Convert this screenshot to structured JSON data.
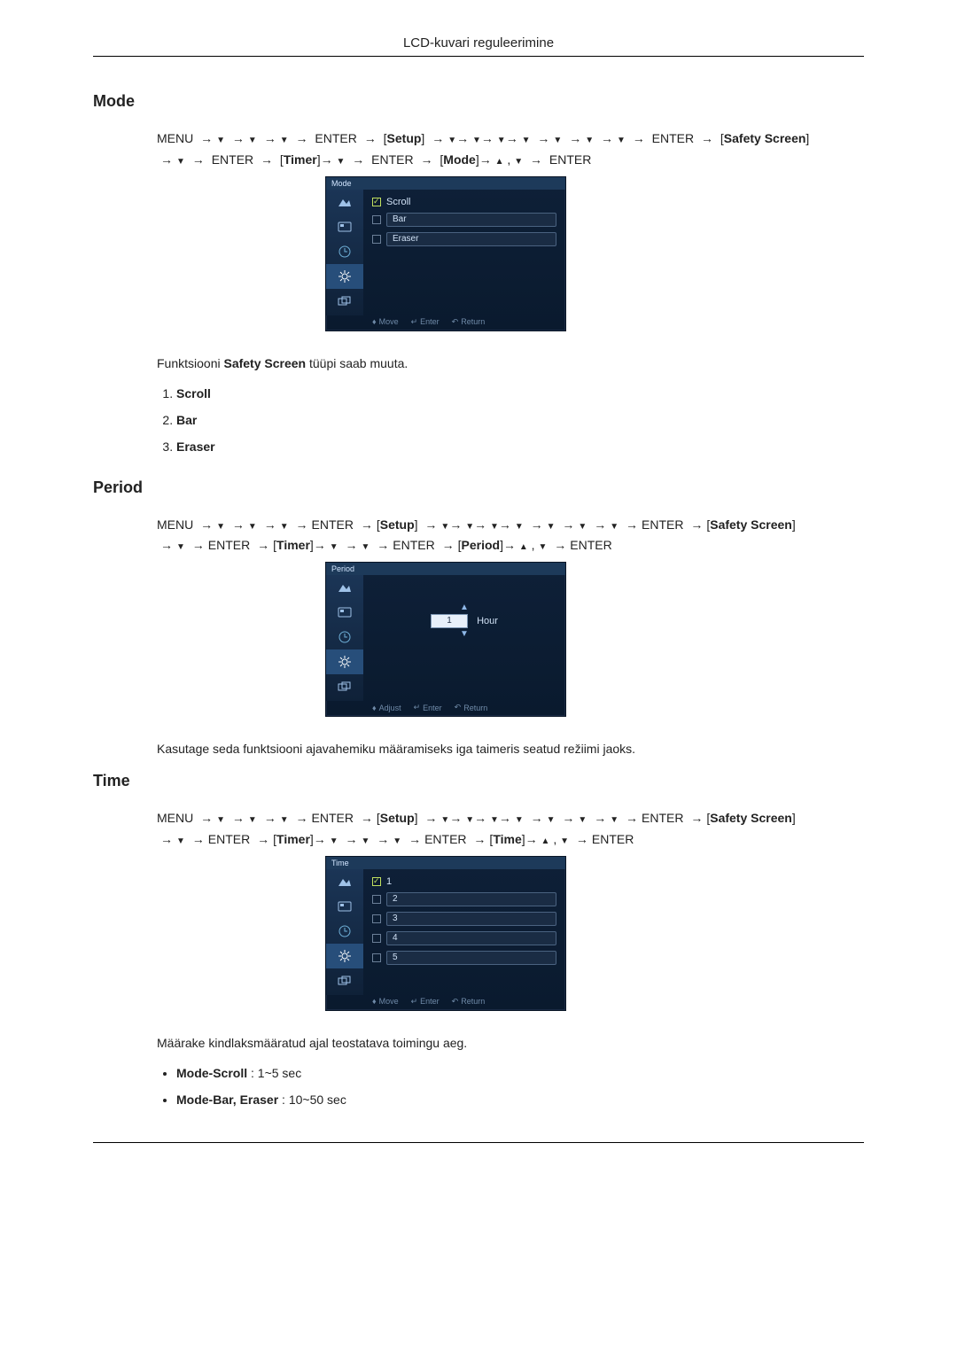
{
  "header": {
    "title": "LCD-kuvari reguleerimine"
  },
  "sections": {
    "mode": {
      "heading": "Mode"
    },
    "period": {
      "heading": "Period"
    },
    "time": {
      "heading": "Time"
    }
  },
  "nav": {
    "menu": "MENU",
    "enter": "ENTER",
    "setup": "Setup",
    "safety_screen": "Safety Screen",
    "timer": "Timer",
    "mode": "Mode",
    "period": "Period",
    "time": "Time"
  },
  "osd_labels": {
    "move": "Move",
    "adjust": "Adjust",
    "enter": "Enter",
    "return": "Return"
  },
  "mode_osd": {
    "title": "Mode",
    "options": [
      "Scroll",
      "Bar",
      "Eraser"
    ],
    "selected_index": 0
  },
  "mode_text": {
    "intro_prefix": "Funktsiooni ",
    "intro_bold": "Safety Screen",
    "intro_suffix": " tüüpi saab muuta.",
    "items": [
      "Scroll",
      "Bar",
      "Eraser"
    ]
  },
  "period_osd": {
    "title": "Period",
    "value": "1",
    "unit": "Hour"
  },
  "period_text": {
    "body": "Kasutage seda funktsiooni ajavahemiku määramiseks iga taimeris seatud režiimi jaoks."
  },
  "time_osd": {
    "title": "Time",
    "options": [
      "1",
      "2",
      "3",
      "4",
      "5"
    ],
    "selected_index": 0
  },
  "time_text": {
    "body": "Määrake kindlaksmääratud ajal teostatava toimingu aeg.",
    "bullets": [
      {
        "bold": "Mode-Scroll",
        "rest": " : 1~5 sec"
      },
      {
        "bold": "Mode-Bar, Eraser",
        "rest": " : 10~50 sec"
      }
    ]
  },
  "chart_data": {
    "type": "table",
    "title": "Safety Screen – Timer settings",
    "rows": [
      {
        "setting": "Mode",
        "options": [
          "Scroll",
          "Bar",
          "Eraser"
        ],
        "selected": "Scroll"
      },
      {
        "setting": "Period",
        "value": 1,
        "unit": "Hour"
      },
      {
        "setting": "Time",
        "options": [
          1,
          2,
          3,
          4,
          5
        ],
        "selected": 1,
        "ranges": {
          "Mode-Scroll": "1~5 sec",
          "Mode-Bar, Eraser": "10~50 sec"
        }
      }
    ]
  }
}
